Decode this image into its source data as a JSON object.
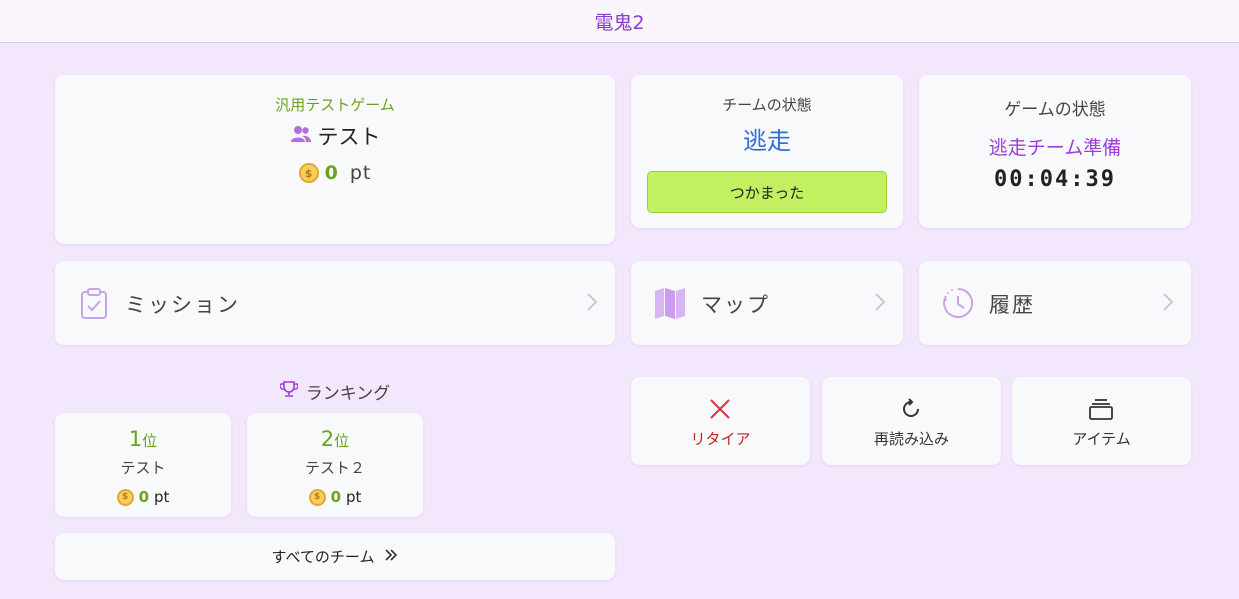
{
  "app": {
    "title": "電鬼2"
  },
  "team_card": {
    "game_name": "汎用テストゲーム",
    "team_name": "テスト",
    "points": "0",
    "points_unit": "pt",
    "icon": "users-icon"
  },
  "team_status": {
    "label": "チームの状態",
    "value": "逃走",
    "caught_button": "つかまった"
  },
  "game_status": {
    "label": "ゲームの状態",
    "phase": "逃走チーム準備",
    "timer": "00:04:39"
  },
  "nav": {
    "mission": {
      "label": "ミッション",
      "icon": "clipboard-check-icon"
    },
    "map": {
      "label": "マップ",
      "icon": "map-icon"
    },
    "history": {
      "label": "履歴",
      "icon": "clock-icon"
    }
  },
  "ranking": {
    "title": "ランキング",
    "icon": "trophy-icon",
    "entries": [
      {
        "rank": "1",
        "rank_suffix": "位",
        "team": "テスト",
        "points": "0",
        "unit": "pt"
      },
      {
        "rank": "2",
        "rank_suffix": "位",
        "team": "テスト２",
        "points": "0",
        "unit": "pt"
      }
    ],
    "all_teams_label": "すべてのチーム"
  },
  "actions": {
    "retire": {
      "label": "リタイア",
      "icon": "x-icon",
      "color": "#c0242c"
    },
    "reload": {
      "label": "再読み込み",
      "icon": "refresh-icon"
    },
    "item": {
      "label": "アイテム",
      "icon": "box-stack-icon"
    }
  },
  "colors": {
    "background": "#f3e7fd",
    "accent_purple": "#8a3fc7",
    "accent_green": "#6aa320",
    "status_blue": "#2f6fd6",
    "button_green": "#c2f060"
  }
}
